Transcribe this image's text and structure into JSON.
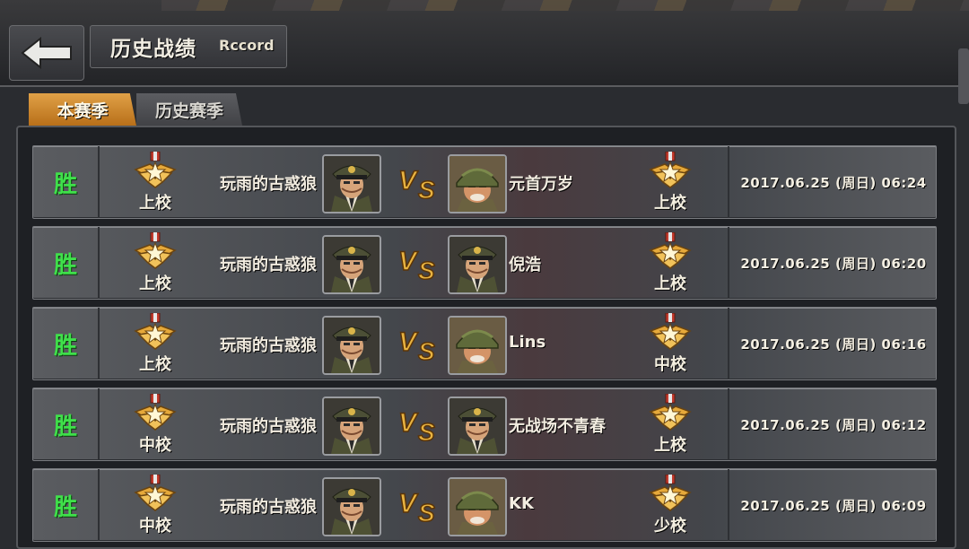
{
  "header": {
    "title_cn": "历史战绩",
    "title_en": "Rccord"
  },
  "tabs": [
    {
      "label": "本赛季",
      "active": true
    },
    {
      "label": "历史赛季",
      "active": false
    }
  ],
  "colors": {
    "win": "#3fe04a",
    "tab_active": "#d08a30"
  },
  "records": [
    {
      "result": "胜",
      "left_rank": "上校",
      "left_name": "玩雨的古惑狼",
      "left_avatar": "officer",
      "right_avatar": "soldier",
      "right_name": "元首万岁",
      "right_rank": "上校",
      "time": "2017.06.25 (周日) 06:24"
    },
    {
      "result": "胜",
      "left_rank": "上校",
      "left_name": "玩雨的古惑狼",
      "left_avatar": "officer",
      "right_avatar": "officer",
      "right_name": "倪浩",
      "right_rank": "上校",
      "time": "2017.06.25 (周日) 06:20"
    },
    {
      "result": "胜",
      "left_rank": "上校",
      "left_name": "玩雨的古惑狼",
      "left_avatar": "officer",
      "right_avatar": "soldier",
      "right_name": "Lins",
      "right_rank": "中校",
      "time": "2017.06.25 (周日) 06:16"
    },
    {
      "result": "胜",
      "left_rank": "中校",
      "left_name": "玩雨的古惑狼",
      "left_avatar": "officer",
      "right_avatar": "officer",
      "right_name": "无战场不青春",
      "right_rank": "上校",
      "time": "2017.06.25 (周日) 06:12"
    },
    {
      "result": "胜",
      "left_rank": "中校",
      "left_name": "玩雨的古惑狼",
      "left_avatar": "officer",
      "right_avatar": "soldier",
      "right_name": "KK",
      "right_rank": "少校",
      "time": "2017.06.25 (周日) 06:09"
    }
  ]
}
